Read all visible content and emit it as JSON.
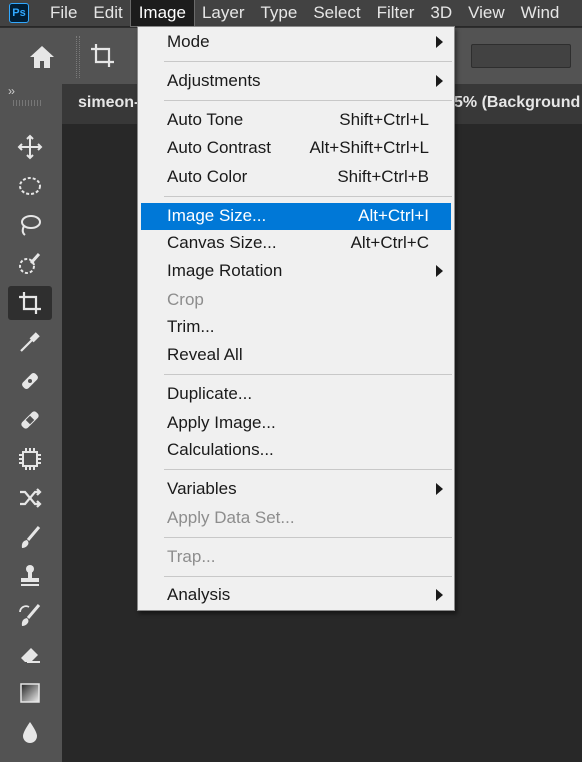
{
  "app": {
    "logo": "Ps"
  },
  "menubar": {
    "items": [
      "File",
      "Edit",
      "Image",
      "Layer",
      "Type",
      "Select",
      "Filter",
      "3D",
      "View",
      "Wind"
    ],
    "active": "Image"
  },
  "tabbar": {
    "tab_left": "simeon-",
    "tab_right": "5% (Background"
  },
  "panelstrip": {
    "chevron": "››"
  },
  "colors": {
    "highlight": "#0078d7",
    "menu_bg": "#f0f0f0",
    "ui_panel": "#535353",
    "canvas": "#282828"
  },
  "toolbar": {
    "tools": [
      "move-icon",
      "marquee-icon",
      "lasso-icon",
      "quick-select-icon",
      "crop-icon",
      "eyedropper-icon",
      "spot-healing-icon",
      "healing-icon",
      "object-select-icon",
      "shuffle-icon",
      "brush-icon",
      "stamp-icon",
      "history-brush-icon",
      "eraser-icon",
      "gradient-icon",
      "blur-icon"
    ],
    "selected": "crop-icon"
  },
  "image_menu": {
    "items": [
      {
        "label": "Mode",
        "shortcut": "",
        "submenu": true,
        "disabled": false
      },
      {
        "label": "Adjustments",
        "shortcut": "",
        "submenu": true,
        "disabled": false
      },
      {
        "label": "Auto Tone",
        "shortcut": "Shift+Ctrl+L",
        "submenu": false,
        "disabled": false
      },
      {
        "label": "Auto Contrast",
        "shortcut": "Alt+Shift+Ctrl+L",
        "submenu": false,
        "disabled": false
      },
      {
        "label": "Auto Color",
        "shortcut": "Shift+Ctrl+B",
        "submenu": false,
        "disabled": false
      },
      {
        "label": "Image Size...",
        "shortcut": "Alt+Ctrl+I",
        "submenu": false,
        "disabled": false,
        "highlighted": true
      },
      {
        "label": "Canvas Size...",
        "shortcut": "Alt+Ctrl+C",
        "submenu": false,
        "disabled": false
      },
      {
        "label": "Image Rotation",
        "shortcut": "",
        "submenu": true,
        "disabled": false
      },
      {
        "label": "Crop",
        "shortcut": "",
        "submenu": false,
        "disabled": true
      },
      {
        "label": "Trim...",
        "shortcut": "",
        "submenu": false,
        "disabled": false
      },
      {
        "label": "Reveal All",
        "shortcut": "",
        "submenu": false,
        "disabled": false
      },
      {
        "label": "Duplicate...",
        "shortcut": "",
        "submenu": false,
        "disabled": false
      },
      {
        "label": "Apply Image...",
        "shortcut": "",
        "submenu": false,
        "disabled": false
      },
      {
        "label": "Calculations...",
        "shortcut": "",
        "submenu": false,
        "disabled": false
      },
      {
        "label": "Variables",
        "shortcut": "",
        "submenu": true,
        "disabled": false
      },
      {
        "label": "Apply Data Set...",
        "shortcut": "",
        "submenu": false,
        "disabled": true
      },
      {
        "label": "Trap...",
        "shortcut": "",
        "submenu": false,
        "disabled": true
      },
      {
        "label": "Analysis",
        "shortcut": "",
        "submenu": true,
        "disabled": false
      }
    ]
  }
}
